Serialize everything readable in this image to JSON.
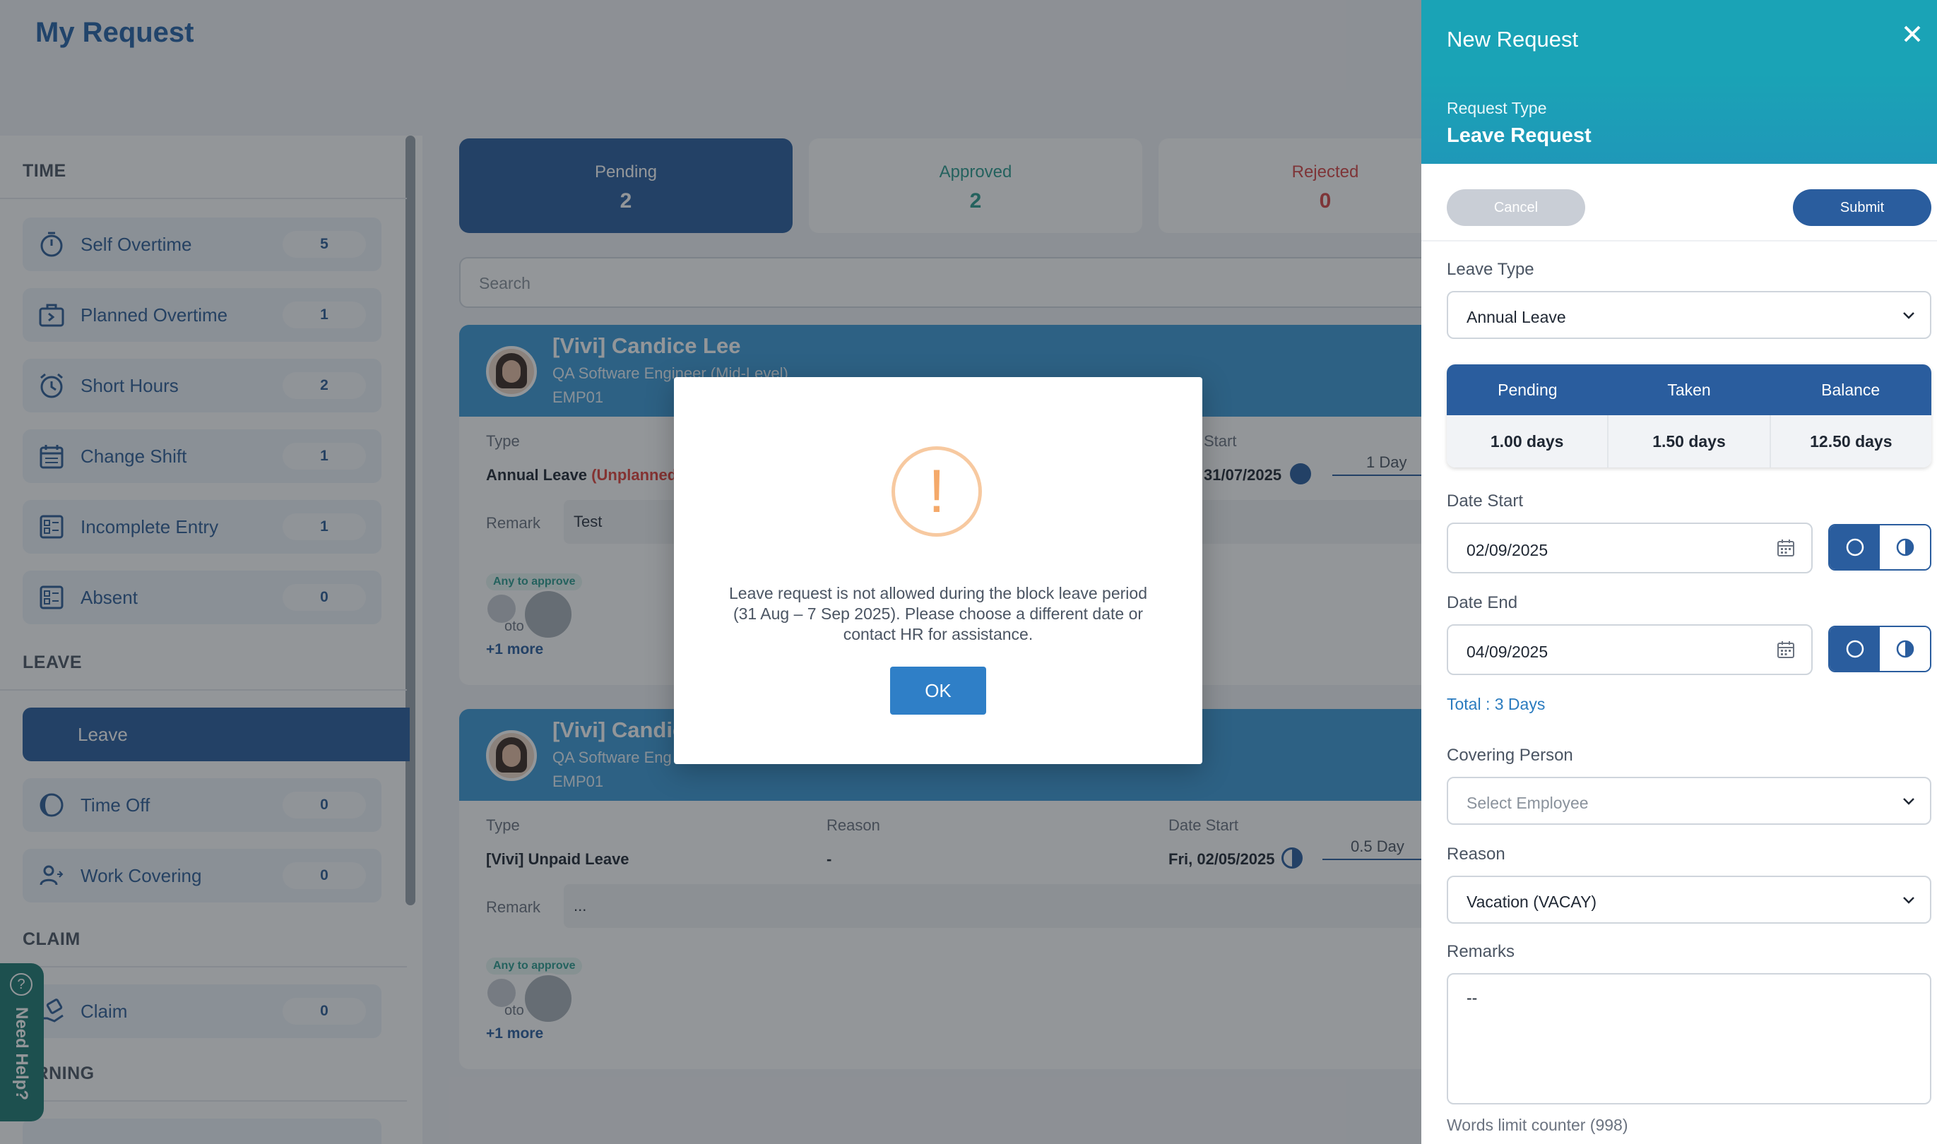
{
  "page": {
    "title": "My Request"
  },
  "sidebar": {
    "sections": {
      "time": "TIME",
      "leave": "LEAVE",
      "claim": "CLAIM",
      "learning": "ARNING"
    },
    "items": [
      {
        "label": "Self Overtime",
        "count": "5",
        "icon": "stopwatch-icon"
      },
      {
        "label": "Planned Overtime",
        "count": "1",
        "icon": "briefcase-clock-icon"
      },
      {
        "label": "Short Hours",
        "count": "2",
        "icon": "alarm-clock-icon"
      },
      {
        "label": "Change Shift",
        "count": "1",
        "icon": "calendar-icon"
      },
      {
        "label": "Incomplete Entry",
        "count": "1",
        "icon": "grid-form-icon"
      },
      {
        "label": "Absent",
        "count": "0",
        "icon": "grid-form-icon"
      },
      {
        "label": "Leave",
        "count": "",
        "icon": ""
      },
      {
        "label": "Time Off",
        "count": "0",
        "icon": "half-moon-icon"
      },
      {
        "label": "Work Covering",
        "count": "0",
        "icon": "person-swap-icon"
      },
      {
        "label": "Claim",
        "count": "0",
        "icon": "hand-money-icon"
      }
    ]
  },
  "tabs": [
    {
      "label": "Pending",
      "value": "2"
    },
    {
      "label": "Approved",
      "value": "2"
    },
    {
      "label": "Rejected",
      "value": "0"
    }
  ],
  "search": {
    "placeholder": "Search"
  },
  "cards": [
    {
      "name": "[Vivi] Candice Lee",
      "role": "QA Software Engineer (Mid-Level)",
      "emp": "EMP01",
      "type_label": "Type",
      "type_value": "Annual Leave",
      "type_flag": "(Unplanned)",
      "date_label": "Start",
      "date_value": "31/07/2025",
      "duration": "1 Day",
      "remark_label": "Remark",
      "remark_value": "Test",
      "approve_tag": "Any to approve",
      "avatar_alt": "oto",
      "more": "+1 more"
    },
    {
      "name": "[Vivi] Candic",
      "role": "QA Software Eng",
      "emp": "EMP01",
      "type_label": "Type",
      "type_value": "[Vivi] Unpaid Leave",
      "reason_label": "Reason",
      "reason_value": "-",
      "date_label": "Date Start",
      "date_value": "Fri, 02/05/2025",
      "duration": "0.5 Day",
      "remark_label": "Remark",
      "remark_value": "...",
      "approve_tag": "Any to approve",
      "avatar_alt": "oto",
      "more": "+1 more"
    }
  ],
  "drawer": {
    "title": "New Request",
    "request_type_label": "Request Type",
    "request_type_value": "Leave Request",
    "cancel": "Cancel",
    "submit": "Submit",
    "leave_type_label": "Leave Type",
    "leave_type_value": "Annual Leave",
    "balance": {
      "headers": [
        "Pending",
        "Taken",
        "Balance"
      ],
      "values": [
        "1.00 days",
        "1.50 days",
        "12.50 days"
      ]
    },
    "date_start_label": "Date Start",
    "date_start_value": "02/09/2025",
    "date_end_label": "Date End",
    "date_end_value": "04/09/2025",
    "total": "Total : 3 Days",
    "covering_label": "Covering Person",
    "covering_placeholder": "Select Employee",
    "reason_label": "Reason",
    "reason_value": "Vacation (VACAY)",
    "remarks_label": "Remarks",
    "remarks_value": "--",
    "counter": "Words limit counter (998)"
  },
  "modal": {
    "icon": "!",
    "message": "Leave request is not allowed during the block leave period (31 Aug – 7 Sep 2025). Please choose a different date or contact HR for assistance.",
    "ok": "OK"
  },
  "help": {
    "label": "Need Help?",
    "icon": "?"
  },
  "colors": {
    "primary": "#2a5d9e",
    "teal": "#1aa3b6",
    "warning": "#f4a96a",
    "danger": "#d64545",
    "success": "#2b9b8e"
  }
}
